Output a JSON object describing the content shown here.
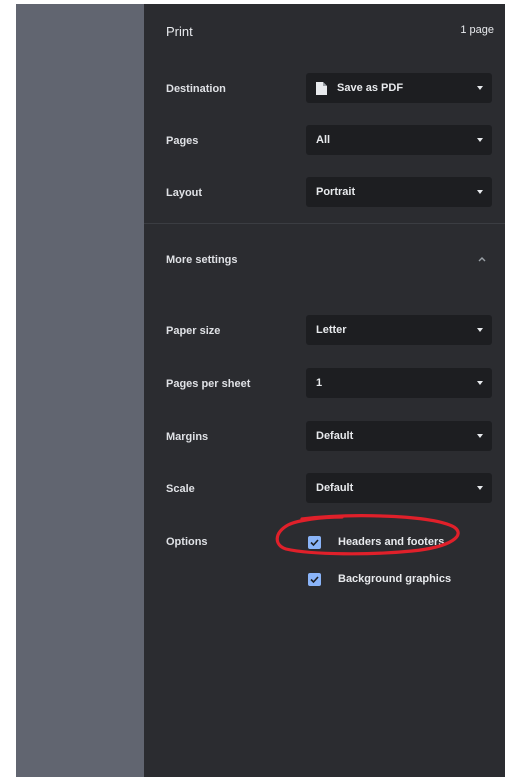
{
  "header": {
    "title": "Print",
    "page_count": "1 page"
  },
  "destination": {
    "label": "Destination",
    "value": "Save as PDF",
    "icon": "document-icon"
  },
  "pages": {
    "label": "Pages",
    "value": "All"
  },
  "layout": {
    "label": "Layout",
    "value": "Portrait"
  },
  "more_settings": {
    "label": "More settings",
    "icon": "chevron-up-icon"
  },
  "paper_size": {
    "label": "Paper size",
    "value": "Letter"
  },
  "pages_per_sheet": {
    "label": "Pages per sheet",
    "value": "1"
  },
  "margins": {
    "label": "Margins",
    "value": "Default"
  },
  "scale": {
    "label": "Scale",
    "value": "Default"
  },
  "options": {
    "label": "Options",
    "items": [
      {
        "label": "Headers and footers",
        "checked": true
      },
      {
        "label": "Background graphics",
        "checked": true
      }
    ]
  },
  "colors": {
    "panel": "#2b2c30",
    "select": "#1d1e21",
    "checkbox": "#8ab4f8",
    "annotation": "#e0202a"
  }
}
